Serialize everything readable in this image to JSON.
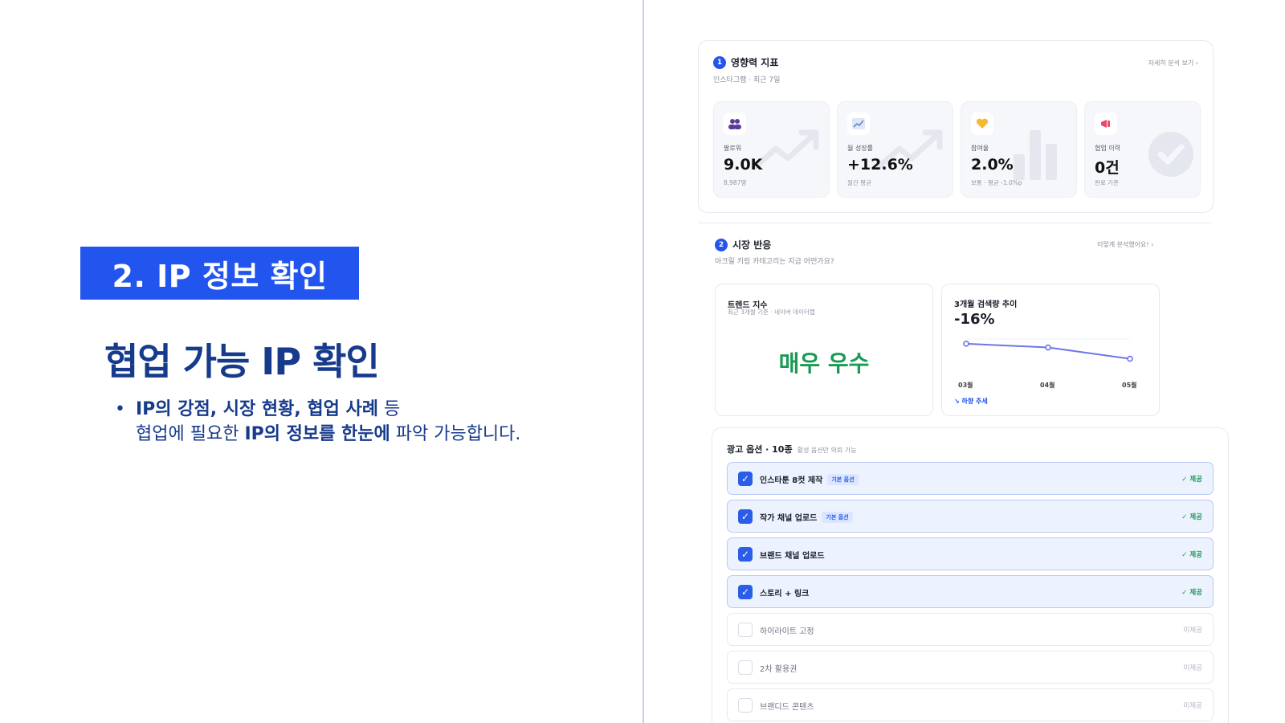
{
  "slide": {
    "section_tag": "2. IP 정보 확인",
    "title": "협업 가능 IP 확인",
    "bullet_dot": "•",
    "bullet_line1_bold": "IP의 강점, 시장 현황, 협업 사례",
    "bullet_line1_rest": " 등",
    "bullet_line2_pre": "협업에 필요한 ",
    "bullet_line2_bold": "IP의 정보를 한눈에",
    "bullet_line2_post": " 파악 가능합니다."
  },
  "influence": {
    "num": "1",
    "title": "영향력 지표",
    "subtitle": "인스타그램 · 최근 7일",
    "link": "자세히 분석 보기 ›",
    "stats": [
      {
        "label": "팔로워",
        "value": "9.0K",
        "caption": "8,987명",
        "icon": "users-icon"
      },
      {
        "label": "월 성장률",
        "value": "+12.6%",
        "caption": "월간 평균",
        "icon": "chart-icon"
      },
      {
        "label": "참여율",
        "value": "2.0%",
        "caption": "보통 · 평균 -1.0%p",
        "icon": "heart-icon"
      },
      {
        "label": "협업 이력",
        "value": "0건",
        "caption": "완료 기준",
        "icon": "megaphone-icon"
      }
    ]
  },
  "market": {
    "num": "2",
    "title": "시장 반응",
    "subtitle": "아크릴 키링 카테고리는 지금 어떤가요?",
    "link": "이렇게 분석했어요! ›",
    "trend": {
      "title": "트렌드 지수",
      "subtitle": "최근 3개월 기준 · 네이버 데이터랩",
      "value": "매우 우수"
    },
    "search": {
      "title": "3개월 검색량 추이",
      "change": "-16%",
      "note": "↘ 하향 추세"
    }
  },
  "chart_data": {
    "type": "line",
    "x": [
      "03월",
      "04월",
      "05월"
    ],
    "series": [
      {
        "values": [
          100,
          96,
          84
        ]
      }
    ],
    "ylim": [
      70,
      105
    ]
  },
  "ads": {
    "title": "광고 옵션 · 10종",
    "subtitle": "활성 옵션만 의뢰 가능",
    "options": [
      {
        "name": "인스타툰 8컷 제작",
        "badge": "기본 옵션",
        "status": "✓ 제공",
        "on": true
      },
      {
        "name": "작가 채널 업로드",
        "badge": "기본 옵션",
        "status": "✓ 제공",
        "on": true
      },
      {
        "name": "브랜드 채널 업로드",
        "badge": "",
        "status": "✓ 제공",
        "on": true
      },
      {
        "name": "스토리 + 링크",
        "badge": "",
        "status": "✓ 제공",
        "on": true
      },
      {
        "name": "하이라이트 고정",
        "badge": "",
        "status": "미제공",
        "on": false
      },
      {
        "name": "2차 활용권",
        "badge": "",
        "status": "미제공",
        "on": false
      },
      {
        "name": "브랜디드 콘텐츠",
        "badge": "",
        "status": "미제공",
        "on": false
      }
    ]
  }
}
